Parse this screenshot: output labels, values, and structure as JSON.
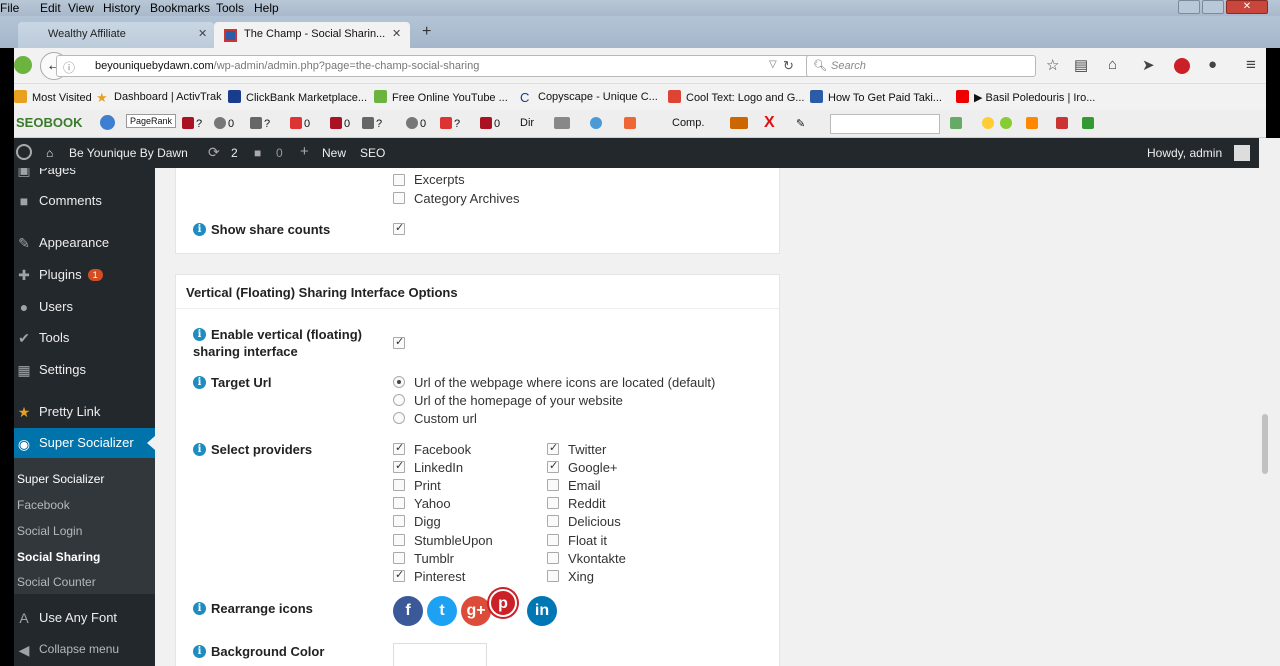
{
  "browser": {
    "menu": [
      "File",
      "Edit",
      "View",
      "History",
      "Bookmarks",
      "Tools",
      "Help"
    ],
    "tabs": [
      {
        "label": "Wealthy Affiliate",
        "active": false
      },
      {
        "label": "The Champ - Social Sharin...",
        "active": true
      }
    ],
    "new_tab": "+",
    "url": {
      "host": "beyouniquebydawn.com",
      "path": "/wp-admin/admin.php?page=the-champ-social-sharing"
    },
    "search_placeholder": "Search",
    "bookmarks": [
      "Most Visited",
      "Dashboard | ActivTrak",
      "ClickBank Marketplace...",
      "Free Online YouTube ...",
      "Copyscape - Unique C...",
      "Cool Text: Logo and G...",
      "How To Get Paid Taki...",
      "▶ Basil Poledouris | Iro..."
    ],
    "seo_toolbar": {
      "brand": "SEOBOOK",
      "pagerank": "PageRank",
      "items": [
        "?",
        "0",
        "?",
        "0",
        "0",
        "?",
        "0",
        "?",
        "0",
        "?"
      ],
      "dir": "Dir",
      "comp": "Comp."
    }
  },
  "adminbar": {
    "site": "Be Younique By Dawn",
    "updates": "2",
    "comments": "0",
    "new": "New",
    "seo": "SEO",
    "howdy": "Howdy, admin"
  },
  "sidebar": {
    "items": [
      {
        "label": "Pages",
        "icon": "pages-icon"
      },
      {
        "label": "Comments",
        "icon": "comments-icon"
      },
      {
        "label": "Appearance",
        "icon": "appearance-icon"
      },
      {
        "label": "Plugins",
        "icon": "plugins-icon",
        "badge": "1"
      },
      {
        "label": "Users",
        "icon": "users-icon"
      },
      {
        "label": "Tools",
        "icon": "tools-icon"
      },
      {
        "label": "Settings",
        "icon": "settings-icon"
      },
      {
        "label": "Pretty Link",
        "icon": "star-icon"
      },
      {
        "label": "Super Socializer",
        "icon": "socializer-icon",
        "active": true
      }
    ],
    "submenu": [
      "Super Socializer",
      "Facebook",
      "Social Login",
      "Social Sharing",
      "Social Counter"
    ],
    "after": [
      {
        "label": "Use Any Font",
        "icon": "font-icon"
      },
      {
        "label": "Collapse menu",
        "icon": "collapse-icon"
      }
    ]
  },
  "panel1": {
    "options": [
      "Excerpts",
      "Category Archives"
    ],
    "show_share_counts": "Show share counts"
  },
  "panel2": {
    "title": "Vertical (Floating) Sharing Interface Options",
    "enable_label_1": "Enable vertical (floating)",
    "enable_label_2": "sharing interface",
    "target_url_label": "Target Url",
    "target_options": [
      "Url of the webpage where icons are located (default)",
      "Url of the homepage of your website",
      "Custom url"
    ],
    "target_selected": 0,
    "providers_label": "Select providers",
    "providers_left": [
      {
        "name": "Facebook",
        "checked": true
      },
      {
        "name": "LinkedIn",
        "checked": true
      },
      {
        "name": "Print",
        "checked": false
      },
      {
        "name": "Yahoo",
        "checked": false
      },
      {
        "name": "Digg",
        "checked": false
      },
      {
        "name": "StumbleUpon",
        "checked": false
      },
      {
        "name": "Tumblr",
        "checked": false
      },
      {
        "name": "Pinterest",
        "checked": true
      }
    ],
    "providers_right": [
      {
        "name": "Twitter",
        "checked": true
      },
      {
        "name": "Google+",
        "checked": true
      },
      {
        "name": "Email",
        "checked": false
      },
      {
        "name": "Reddit",
        "checked": false
      },
      {
        "name": "Delicious",
        "checked": false
      },
      {
        "name": "Float it",
        "checked": false
      },
      {
        "name": "Vkontakte",
        "checked": false
      },
      {
        "name": "Xing",
        "checked": false
      }
    ],
    "rearrange_label": "Rearrange icons",
    "icons": [
      {
        "glyph": "f",
        "name": "facebook-share-icon",
        "color": "#3b5998"
      },
      {
        "glyph": "t",
        "name": "twitter-share-icon",
        "color": "#1da1f2"
      },
      {
        "glyph": "g+",
        "name": "googleplus-share-icon",
        "color": "#dd4b39"
      },
      {
        "glyph": "p",
        "name": "pinterest-share-icon",
        "color": "#cb2027"
      },
      {
        "glyph": "in",
        "name": "linkedin-share-icon",
        "color": "#0077b5"
      }
    ],
    "bg_color_label": "Background Color"
  }
}
